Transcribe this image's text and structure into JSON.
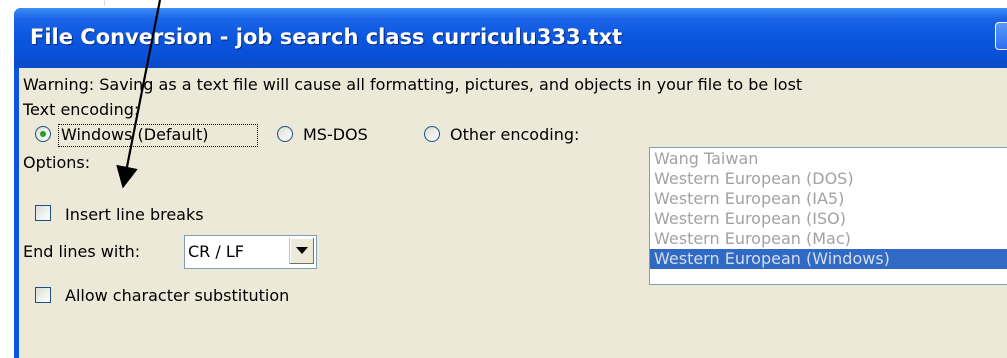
{
  "window": {
    "title": "File Conversion - job search class curriculu333.txt"
  },
  "warning": {
    "text": "Warning: Saving as a text file will cause all formatting, pictures, and objects in your file to be lost"
  },
  "encoding": {
    "label": "Text encoding:",
    "options": [
      {
        "label": "Windows (Default)",
        "selected": true
      },
      {
        "label": "MS-DOS",
        "selected": false
      },
      {
        "label": "Other encoding:",
        "selected": false
      }
    ],
    "list_items": [
      "Wang Taiwan",
      "Western European (DOS)",
      "Western European (IA5)",
      "Western European (ISO)",
      "Western European (Mac)",
      "Western European (Windows)"
    ],
    "list_selected": "Western European (Windows)"
  },
  "options": {
    "label": "Options:",
    "insert_line_breaks": {
      "label": "Insert line breaks",
      "checked": false
    },
    "end_lines": {
      "label": "End lines with:",
      "value": "CR / LF"
    },
    "allow_substitution": {
      "label": "Allow character substitution",
      "checked": false
    }
  },
  "colors": {
    "titlebar": "#0a55e0",
    "dialog_bg": "#ece9d8",
    "selection": "#316ac5",
    "radio_dot": "#21a121"
  }
}
